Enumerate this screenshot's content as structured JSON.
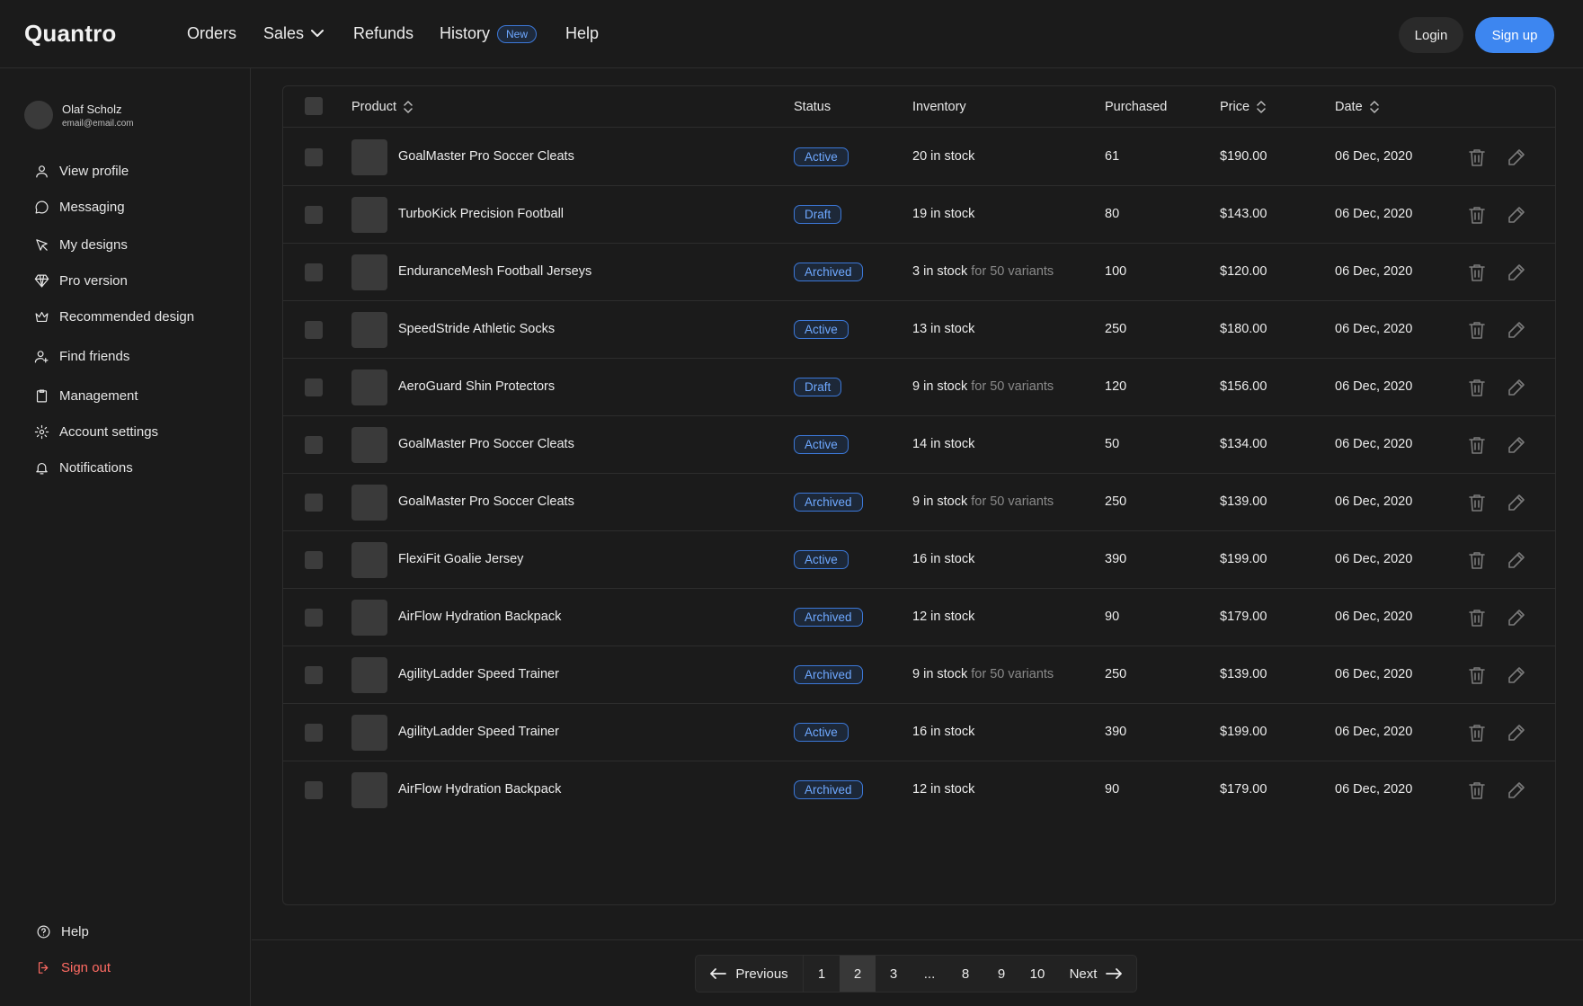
{
  "brand": "Quantro",
  "nav": {
    "orders": "Orders",
    "sales": "Sales",
    "refunds": "Refunds",
    "history": "History",
    "history_badge": "New",
    "help": "Help",
    "login": "Login",
    "signup": "Sign up"
  },
  "user": {
    "name": "Olaf Scholz",
    "email": "email@email.com"
  },
  "sidebar": {
    "items": [
      {
        "label": "View profile",
        "icon": "user-icon"
      },
      {
        "label": "Messaging",
        "icon": "message-icon"
      },
      {
        "label": "My designs",
        "icon": "pen-tool-icon"
      },
      {
        "label": "Pro version",
        "icon": "diamond-icon"
      },
      {
        "label": "Recommended design",
        "icon": "crown-icon"
      },
      {
        "label": "Find friends",
        "icon": "user-plus-icon"
      },
      {
        "label": "Management",
        "icon": "clipboard-icon"
      },
      {
        "label": "Account settings",
        "icon": "gear-icon"
      },
      {
        "label": "Notifications",
        "icon": "bell-icon"
      }
    ],
    "help": "Help",
    "signout": "Sign out"
  },
  "table": {
    "headers": {
      "product": "Product",
      "status": "Status",
      "inventory": "Inventory",
      "purchased": "Purchased",
      "price": "Price",
      "date": "Date"
    },
    "rows": [
      {
        "name": "GoalMaster Pro Soccer Cleats",
        "status": "Active",
        "stock": "20 in stock",
        "variants": "",
        "purchased": "61",
        "price": "$190.00",
        "date": "06 Dec, 2020"
      },
      {
        "name": "TurboKick Precision Football",
        "status": "Draft",
        "stock": "19 in stock",
        "variants": "",
        "purchased": "80",
        "price": "$143.00",
        "date": "06 Dec, 2020"
      },
      {
        "name": "EnduranceMesh Football Jerseys",
        "status": "Archived",
        "stock": "3 in stock",
        "variants": "for 50 variants",
        "purchased": "100",
        "price": "$120.00",
        "date": "06 Dec, 2020"
      },
      {
        "name": "SpeedStride Athletic Socks",
        "status": "Active",
        "stock": "13 in stock",
        "variants": "",
        "purchased": "250",
        "price": "$180.00",
        "date": "06 Dec, 2020"
      },
      {
        "name": "AeroGuard Shin Protectors",
        "status": "Draft",
        "stock": "9 in stock",
        "variants": "for 50 variants",
        "purchased": "120",
        "price": "$156.00",
        "date": "06 Dec, 2020"
      },
      {
        "name": "GoalMaster Pro Soccer Cleats",
        "status": "Active",
        "stock": "14 in stock",
        "variants": "",
        "purchased": "50",
        "price": "$134.00",
        "date": "06 Dec, 2020"
      },
      {
        "name": "GoalMaster Pro Soccer Cleats",
        "status": "Archived",
        "stock": "9 in stock",
        "variants": "for 50 variants",
        "purchased": "250",
        "price": "$139.00",
        "date": "06 Dec, 2020"
      },
      {
        "name": "FlexiFit Goalie Jersey",
        "status": "Active",
        "stock": "16 in stock",
        "variants": "",
        "purchased": "390",
        "price": "$199.00",
        "date": "06 Dec, 2020"
      },
      {
        "name": "AirFlow Hydration Backpack",
        "status": "Archived",
        "stock": "12 in stock",
        "variants": "",
        "purchased": "90",
        "price": "$179.00",
        "date": "06 Dec, 2020"
      },
      {
        "name": "AgilityLadder Speed Trainer",
        "status": "Archived",
        "stock": "9 in stock",
        "variants": "for 50 variants",
        "purchased": "250",
        "price": "$139.00",
        "date": "06 Dec, 2020"
      },
      {
        "name": "AgilityLadder Speed Trainer",
        "status": "Active",
        "stock": "16 in stock",
        "variants": "",
        "purchased": "390",
        "price": "$199.00",
        "date": "06 Dec, 2020"
      },
      {
        "name": "AirFlow Hydration Backpack",
        "status": "Archived",
        "stock": "12 in stock",
        "variants": "",
        "purchased": "90",
        "price": "$179.00",
        "date": "06 Dec, 2020"
      }
    ]
  },
  "pagination": {
    "previous": "Previous",
    "next": "Next",
    "pages": [
      "1",
      "2",
      "3",
      "...",
      "8",
      "9",
      "10"
    ],
    "current": "2"
  },
  "colors": {
    "accent": "#3d86f0",
    "badge": "#6ea8ff",
    "danger": "#ff6b63"
  }
}
